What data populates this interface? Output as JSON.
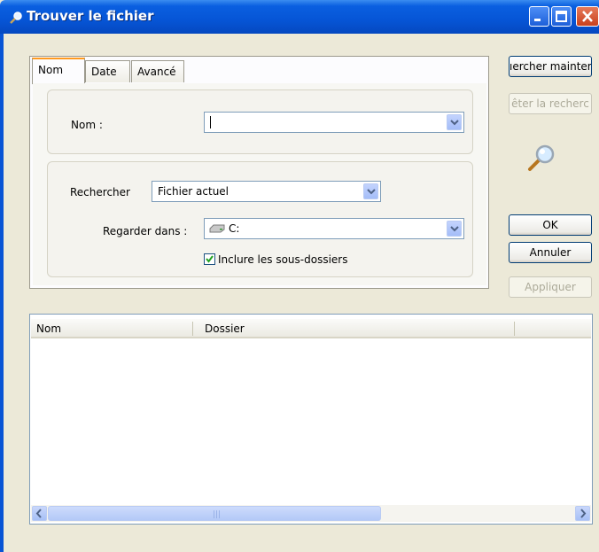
{
  "window": {
    "title": "Trouver le fichier",
    "controls": [
      "minimize",
      "maximize",
      "close"
    ]
  },
  "tabs": [
    {
      "label": "Nom",
      "active": true
    },
    {
      "label": "Date",
      "active": false
    },
    {
      "label": "Avancé",
      "active": false
    }
  ],
  "name_group": {
    "label": "Nom :",
    "value": ""
  },
  "search_group": {
    "search_label": "Rechercher",
    "search_value": "Fichier actuel",
    "look_in_label": "Regarder dans :",
    "look_in_value": "C:",
    "include_subfolders_label": "Inclure les sous-dossiers",
    "include_subfolders_checked": true
  },
  "side_buttons": {
    "search_now": "ıercher mainter",
    "stop_search": "êter la recherc",
    "ok": "OK",
    "cancel": "Annuler",
    "apply": "Appliquer"
  },
  "results": {
    "columns": [
      "Nom",
      "Dossier"
    ],
    "rows": []
  },
  "icons": {
    "title": "magnifier-icon",
    "search": "magnifier-icon",
    "drive": "drive-icon"
  }
}
